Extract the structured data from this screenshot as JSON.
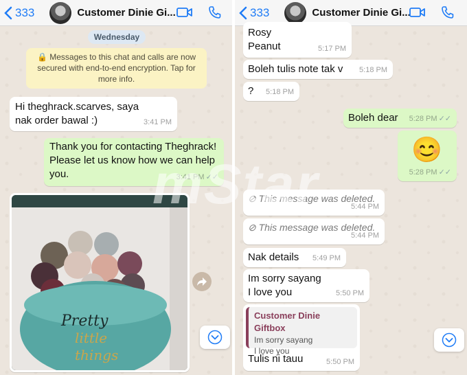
{
  "left": {
    "header": {
      "back_count": "333",
      "contact_name": "Customer Dinie Gi..."
    },
    "day_label": "Wednesday",
    "encryption_notice": "Messages to this chat and calls are now secured with end-to-end encryption. Tap for more info.",
    "messages": [
      {
        "text": "Hi theghrack.scarves, saya nak order bawal :)",
        "time": "3:41 PM"
      },
      {
        "text": "Thank you for contacting Theghrack! Please let us know how we can help you.",
        "time": "3:41 PM"
      }
    ],
    "image_text": "Pretty little things"
  },
  "right": {
    "header": {
      "back_count": "333",
      "contact_name": "Customer Dinie Gi..."
    },
    "messages": [
      {
        "line1": "Rosy",
        "line2": "Peanut",
        "time": "5:17 PM"
      },
      {
        "text": "Boleh tulis note tak v",
        "time": "5:18 PM"
      },
      {
        "text": "?",
        "time": "5:18 PM"
      },
      {
        "text": "Boleh dear",
        "time": "5:28 PM"
      },
      {
        "emoji": "😊",
        "time": "5:28 PM"
      },
      {
        "text": "This message was deleted.",
        "time": "5:44 PM"
      },
      {
        "text": "This message was deleted.",
        "time": "5:44 PM"
      },
      {
        "text": "Nak details",
        "time": "5:49 PM"
      },
      {
        "line1": "Im sorry sayang",
        "line2": "I love you",
        "time": "5:50 PM"
      },
      {
        "quote_name": "Customer Dinie Giftbox",
        "quote_line1": "Im sorry sayang",
        "quote_line2": "I love you",
        "text": "Tulis ni tauu",
        "time": "5:50 PM"
      }
    ]
  },
  "watermark": "mStar",
  "colors": {
    "accent": "#1f7cf6",
    "incoming": "#ffffff",
    "outgoing": "#dcf8c6",
    "chat_bg": "#ece5dd",
    "quote_accent": "#8a3f5b"
  }
}
